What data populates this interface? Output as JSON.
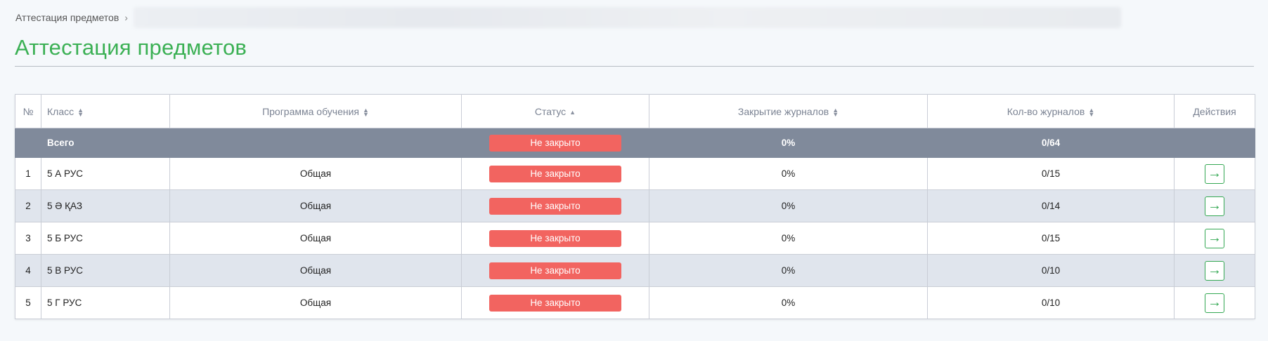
{
  "breadcrumb": {
    "item": "Аттестация предметов",
    "separator": "›"
  },
  "page": {
    "title": "Аттестация предметов"
  },
  "colors": {
    "accent": "#3bb054",
    "status_open": "#f26460",
    "total_row": "#808a9b",
    "alt_row": "#e0e5ed"
  },
  "table": {
    "headers": {
      "num": "№",
      "class": "Класс",
      "program": "Программа обучения",
      "status": "Статус",
      "closing": "Закрытие журналов",
      "count": "Кол-во журналов",
      "actions": "Действия"
    },
    "total": {
      "label": "Всего",
      "status": "Не закрыто",
      "closing": "0%",
      "count": "0/64"
    },
    "rows": [
      {
        "num": "1",
        "class": "5 А РУС",
        "program": "Общая",
        "status": "Не закрыто",
        "closing": "0%",
        "count": "0/15"
      },
      {
        "num": "2",
        "class": "5 Ә ҚАЗ",
        "program": "Общая",
        "status": "Не закрыто",
        "closing": "0%",
        "count": "0/14"
      },
      {
        "num": "3",
        "class": "5 Б РУС",
        "program": "Общая",
        "status": "Не закрыто",
        "closing": "0%",
        "count": "0/15"
      },
      {
        "num": "4",
        "class": "5 В РУС",
        "program": "Общая",
        "status": "Не закрыто",
        "closing": "0%",
        "count": "0/10"
      },
      {
        "num": "5",
        "class": "5 Г РУС",
        "program": "Общая",
        "status": "Не закрыто",
        "closing": "0%",
        "count": "0/10"
      }
    ],
    "action_icon": "arrow-right-icon"
  }
}
